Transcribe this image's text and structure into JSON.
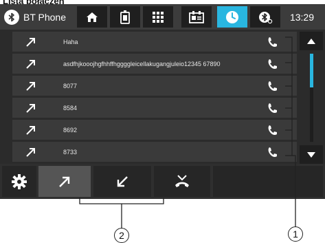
{
  "heading": "Lista połączeń",
  "app": {
    "title": "BT Phone",
    "icon": "bluetooth-icon"
  },
  "topbar": {
    "buttons": [
      {
        "icon": "home-icon"
      },
      {
        "icon": "phonebook-icon"
      },
      {
        "icon": "keypad-icon"
      },
      {
        "icon": "contacts-card-icon"
      },
      {
        "icon": "call-history-clock-icon",
        "active": true
      },
      {
        "icon": "bluetooth-settings-icon"
      }
    ],
    "time": "13:29"
  },
  "call_list": {
    "items": [
      {
        "direction": "outgoing-arrow-icon",
        "name": "Haha"
      },
      {
        "direction": "outgoing-arrow-icon",
        "name": "asdfhjkooojhgfhhffhggggleicellakugangjuleio12345 67890"
      },
      {
        "direction": "outgoing-arrow-icon",
        "name": "8077"
      },
      {
        "direction": "outgoing-arrow-icon",
        "name": "8584"
      },
      {
        "direction": "outgoing-arrow-icon",
        "name": "8692"
      },
      {
        "direction": "outgoing-arrow-icon",
        "name": "8733"
      }
    ],
    "call_icon": "phone-handset-icon"
  },
  "scroll": {
    "position_fraction": 0.0,
    "visible_fraction": 0.38
  },
  "bottombar": {
    "buttons": [
      {
        "icon": "settings-gear-icon"
      },
      {
        "icon": "outgoing-calls-icon",
        "selected": true
      },
      {
        "icon": "incoming-calls-icon"
      },
      {
        "icon": "missed-calls-icon"
      }
    ]
  },
  "callouts": [
    "2",
    "1"
  ],
  "colors": {
    "accent": "#29b6e0",
    "row": "#3a3a3a",
    "background": "#2b2b2b"
  }
}
